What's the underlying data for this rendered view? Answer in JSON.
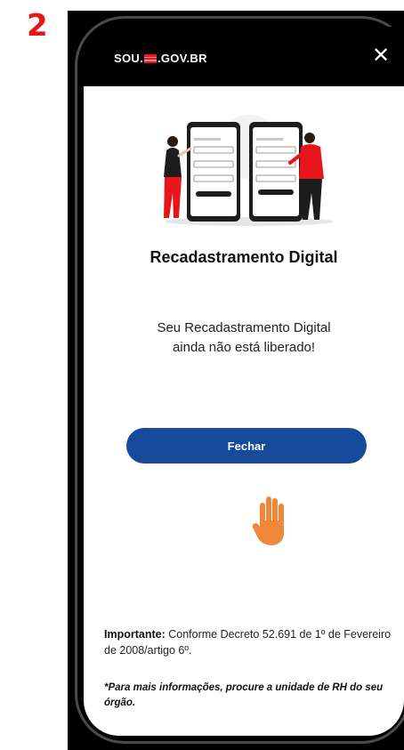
{
  "step_number": "2",
  "header": {
    "brand_prefix": "SOU.",
    "brand_suffix": ".GOV.BR",
    "close_symbol": "✕"
  },
  "main": {
    "title": "Recadastramento Digital",
    "message_line1": "Seu Recadastramento Digital",
    "message_line2": "ainda não está liberado!",
    "close_button_label": "Fechar"
  },
  "footer": {
    "important_label": "Importante:",
    "important_text": " Conforme Decreto 52.691 de 1º de Fevereiro de 2008/artigo 6º.",
    "note": "*Para mais informações, procure a unidade de RH do seu órgão."
  },
  "icons": {
    "hand": "raised-hand-icon",
    "close": "close-icon",
    "flag": "sp-flag-icon"
  },
  "colors": {
    "step_number": "#e8161b",
    "primary_button": "#154a9c",
    "hand": "#f0883a",
    "top_bar": "#000000"
  }
}
